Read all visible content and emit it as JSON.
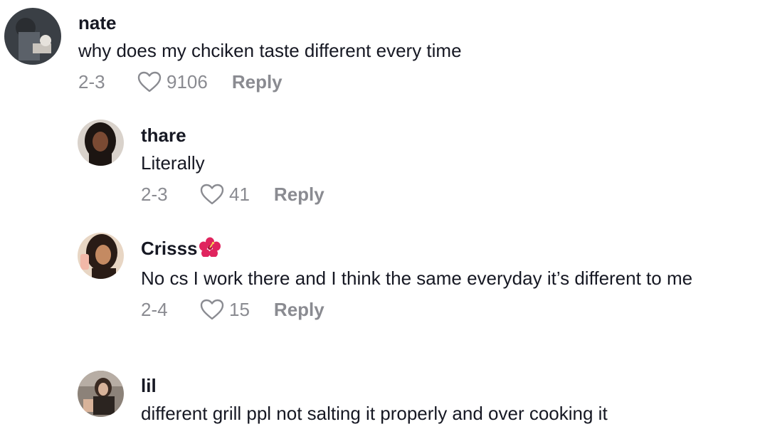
{
  "comments": [
    {
      "username": "nate",
      "text": "why does my chciken taste different every time",
      "date": "2-3",
      "likes": "9106",
      "reply_label": "Reply",
      "avatar_icon": "user-avatar-photo"
    },
    {
      "username": "thare",
      "text": "Literally",
      "date": "2-3",
      "likes": "41",
      "reply_label": "Reply",
      "avatar_icon": "user-avatar-photo"
    },
    {
      "username": "Crisss",
      "username_emoji": "hibiscus-flower-icon",
      "text": "No cs I work there and I think the same everyday it’s different to me",
      "date": "2-4",
      "likes": "15",
      "reply_label": "Reply",
      "avatar_icon": "user-avatar-photo"
    },
    {
      "username": "lil",
      "text": "different grill ppl not salting it properly and over cooking it",
      "avatar_icon": "user-avatar-photo"
    }
  ],
  "colors": {
    "text_primary": "#161823",
    "text_secondary": "#8a8b91",
    "emoji_flower": "#e0245e"
  }
}
